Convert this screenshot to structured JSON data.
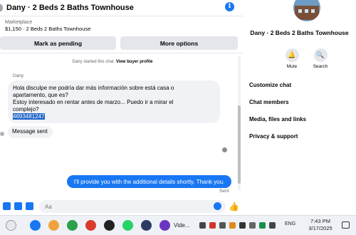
{
  "header": {
    "title": "Dany · 2 Beds 2 Baths Townhouse",
    "info_icon": "i"
  },
  "listing": {
    "kicker": "Marketplace",
    "summary": "$1,150 · 2 Beds 2 Baths Townhouse"
  },
  "actions": {
    "mark_pending": "Mark as pending",
    "more_options": "More options"
  },
  "system_message": {
    "text": "Dany started this chat.",
    "link": "View buyer profile"
  },
  "messages": {
    "sender_name": "Dany",
    "incoming": {
      "line1": "Hola disculpe me podría dar más información sobre está casa o",
      "line2": "apartamento, que es?",
      "line3": "Estoy interesado en rentar antes de marzo... Puedo ir a mirar el",
      "line4": "complejo?",
      "phone": "4693481247"
    },
    "sent_notice": "Message sent",
    "outgoing": "I'll provide you with the additional details shortly. Thank you.",
    "outgoing_status": "Sent"
  },
  "composer": {
    "placeholder": "Aa"
  },
  "side_panel": {
    "title": "Dany · 2 Beds 2 Baths Townhouse",
    "mute_label": "Mute",
    "search_label": "Search",
    "menu": [
      "Customize chat",
      "Chat members",
      "Media, files and links",
      "Privacy & support"
    ]
  },
  "taskbar": {
    "app_label": "Vide...",
    "language": "ENG",
    "time": "7:43 PM",
    "date": "3/17/2025"
  },
  "colors": {
    "accent": "#1877f2",
    "bubble_in": "#f0f2f5",
    "button_bg": "#e4e6eb"
  }
}
